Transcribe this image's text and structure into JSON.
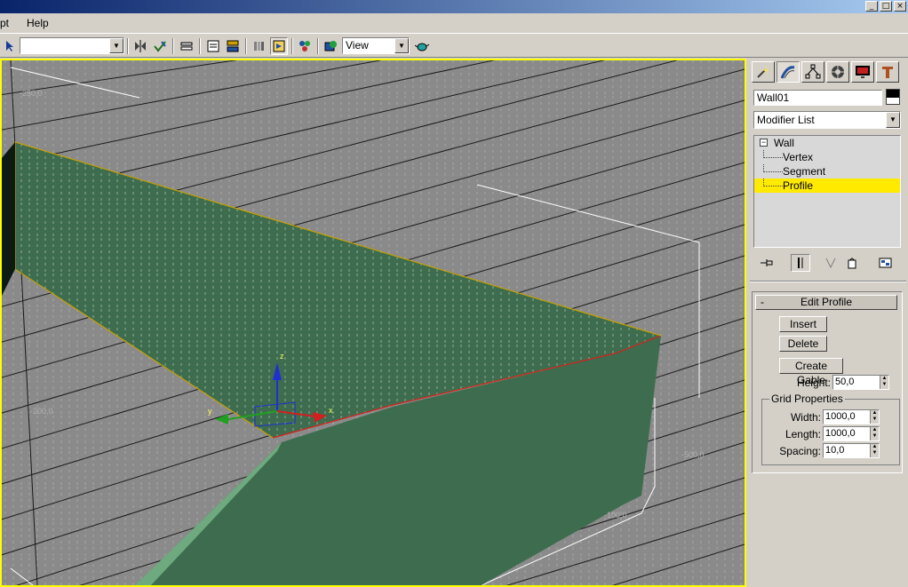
{
  "window": {
    "controls": [
      "_",
      "□",
      "×"
    ]
  },
  "menu": {
    "items": [
      "pt",
      "Help"
    ]
  },
  "toolbar": {
    "selection_set_value": "",
    "reference_coord": "View"
  },
  "viewport": {
    "grid_labels": [
      "-250,0",
      "-200,0",
      "-500,0",
      "-100,0"
    ],
    "gizmo_labels": {
      "x": "x",
      "y": "y",
      "z": "z"
    },
    "colors": {
      "background": "#8a8a8a",
      "wall": "#3d6d4e",
      "wall_edge": "#6fa97f",
      "border": "#ffff00"
    }
  },
  "panel": {
    "object_name": "Wall01",
    "modifier_list": "Modifier List",
    "stack": [
      {
        "label": "Wall",
        "level": 0,
        "selected": false
      },
      {
        "label": "Vertex",
        "level": 1,
        "selected": false
      },
      {
        "label": "Segment",
        "level": 1,
        "selected": false
      },
      {
        "label": "Profile",
        "level": 1,
        "selected": true
      }
    ],
    "rollout": {
      "title": "Edit Profile",
      "collapse": "-",
      "insert": "Insert",
      "delete": "Delete",
      "create_gable": "Create Gable",
      "height_label": "Height:",
      "height_value": "50,0",
      "grid_group_title": "Grid Properties",
      "width_label": "Width:",
      "width_value": "1000,0",
      "length_label": "Length:",
      "length_value": "1000,0",
      "spacing_label": "Spacing:",
      "spacing_value": "10,0"
    }
  }
}
